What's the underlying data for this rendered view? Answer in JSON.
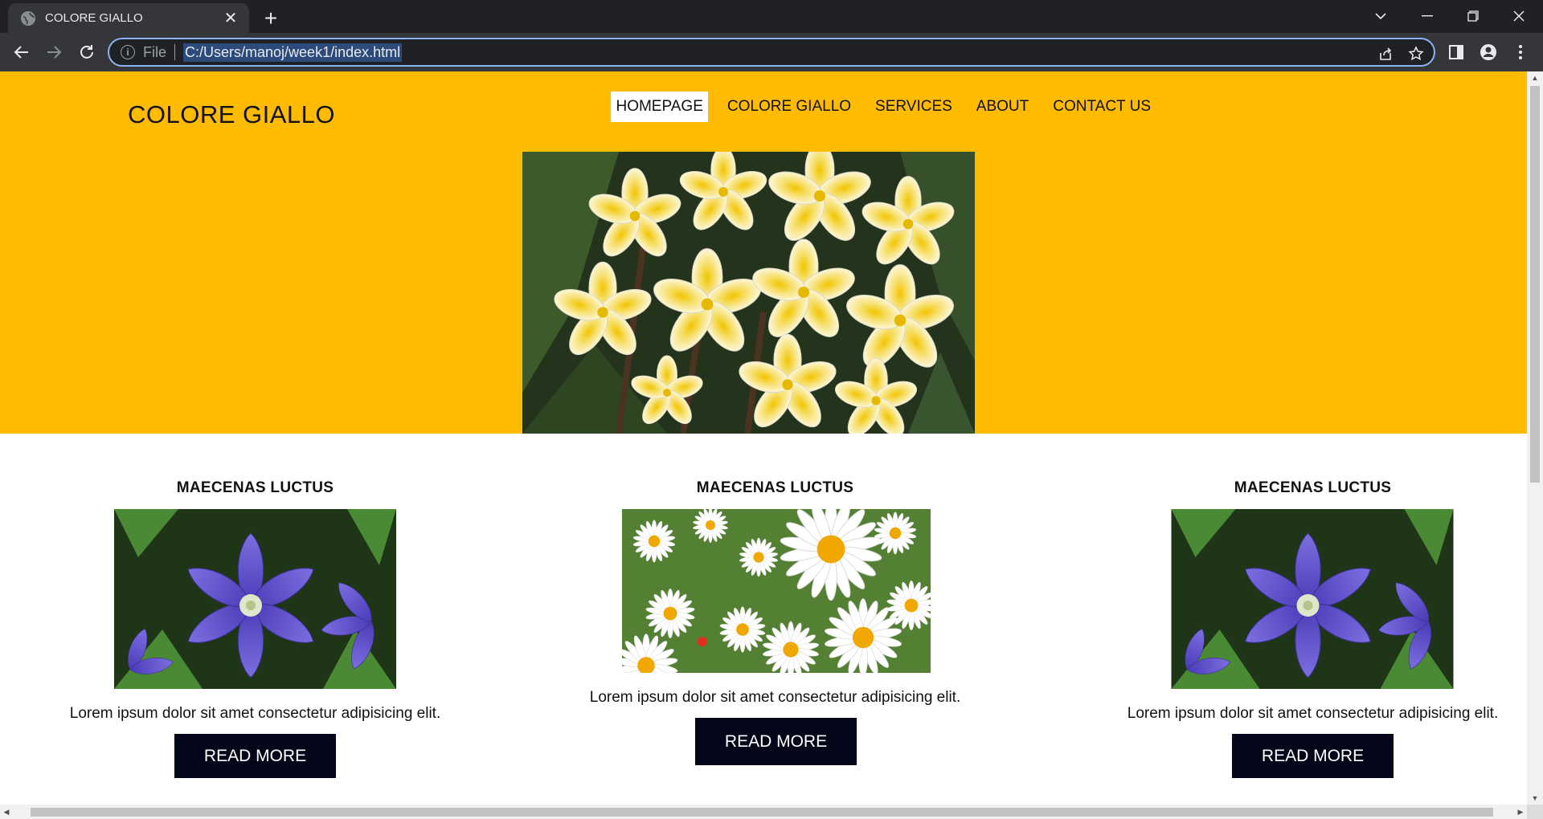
{
  "browser": {
    "tab_title": "COLORE GIALLO",
    "new_tab": "+",
    "scheme_label": "File",
    "url": "C:/Users/manoj/week1/index.html",
    "info_glyph": "i"
  },
  "site": {
    "logo": "COLORE GIALLO",
    "nav": [
      {
        "label": "HOMEPAGE",
        "active": true
      },
      {
        "label": "COLORE GIALLO"
      },
      {
        "label": "SERVICES"
      },
      {
        "label": "ABOUT"
      },
      {
        "label": "CONTACT US"
      }
    ],
    "hero_image": "plumeria-flowers-photo",
    "cards": [
      {
        "title": "MAECENAS LUCTUS",
        "image": "purple-clematis-photo",
        "text": "Lorem ipsum dolor sit amet consectetur adipisicing elit.",
        "button": "READ MORE"
      },
      {
        "title": "MAECENAS LUCTUS",
        "image": "white-daisies-photo",
        "text": "Lorem ipsum dolor sit amet consectetur adipisicing elit.",
        "button": "READ MORE"
      },
      {
        "title": "MAECENAS LUCTUS",
        "image": "purple-clematis-photo",
        "text": "Lorem ipsum dolor sit amet consectetur adipisicing elit.",
        "button": "READ MORE"
      }
    ]
  },
  "colors": {
    "hero_bg": "#ffbb00",
    "button_bg": "#040619",
    "nav_active_bg": "#ffffff",
    "omnibox_focus": "#8ab4f8"
  }
}
